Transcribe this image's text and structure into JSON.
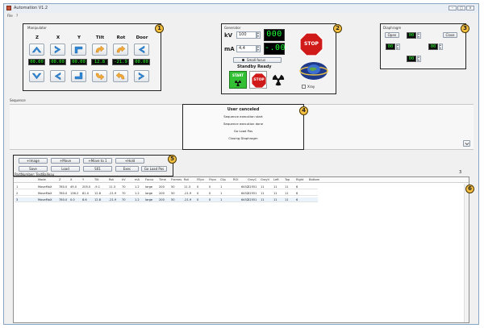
{
  "window": {
    "title": "Automation V1.2",
    "min_label": "–",
    "max_label": "□",
    "close_label": "×"
  },
  "menu": [
    "File",
    "?"
  ],
  "manipulator": {
    "label": "Manipulator",
    "columns": [
      "Z",
      "X",
      "Y",
      "Tilt",
      "Rot",
      "Door"
    ],
    "readouts": [
      "00.00",
      "00.00",
      "00.00",
      "12.8",
      "-21.9",
      "00.00"
    ]
  },
  "generator": {
    "label": "Generator",
    "kv_label": "kV",
    "kv_value": "100",
    "ma_label": "mA",
    "ma_value": "4,4",
    "kv_display": "000",
    "ma_display": "-.00",
    "small_focus_label": "Small focus",
    "standby_label": "Standby Ready",
    "start_label": "START",
    "stop_label": "STOP",
    "stop_sign_label": "STOP",
    "xray_label": "Xray"
  },
  "diaphragm": {
    "label": "Diaphragm",
    "open_label": "Open",
    "close_label": "Close",
    "displays": [
      "00",
      "00",
      "00",
      "00"
    ]
  },
  "sequence": {
    "label": "Sequence",
    "status_title": "User canceled",
    "status_lines": [
      "Sequence execution start",
      "Sequence execution done",
      "Go Load Pos",
      "Closing Diaphragm"
    ]
  },
  "toolbar": {
    "row1": [
      "+Image",
      "+Move",
      "+Move to 1",
      "+Hold"
    ],
    "row2": [
      "Save",
      "Load",
      "S01",
      "Exec",
      "Go Load Pos"
    ],
    "partnumber_label": "PartNumber: TestBalleau",
    "count": "3"
  },
  "callouts": [
    "1",
    "2",
    "3",
    "4",
    "5",
    "6"
  ],
  "table": {
    "headers": [
      "Mode",
      "Z",
      "X",
      "Y",
      "Tilt",
      "Rot",
      "kV",
      "mA",
      "Focus",
      "Time",
      "Frames",
      "Rot",
      "FEpn",
      "Fhpn",
      "Clip",
      "ROI",
      "GrayC",
      "GrayV",
      "Left",
      "Top",
      "Right",
      "Bottom"
    ],
    "rows": [
      [
        "1",
        "MoveMaX",
        "780.0",
        "49.0",
        "205.0",
        "-9.1",
        "11.3",
        "70",
        "1.2",
        "large",
        "200",
        "50",
        "11.3",
        "0",
        "0",
        "1",
        "",
        "6452",
        "22551",
        "11",
        "11",
        "11",
        "6"
      ],
      [
        "2",
        "MoveMaX",
        "780.0",
        "136.2",
        "81.0",
        "12.8",
        "-21.9",
        "70",
        "1.2",
        "large",
        "200",
        "50",
        "-21.9",
        "0",
        "0",
        "1",
        "",
        "6452",
        "22551",
        "11",
        "11",
        "11",
        "6"
      ],
      [
        "3",
        "MoveMaX",
        "780.0",
        "0.0",
        "8.6",
        "12.8",
        "-21.9",
        "70",
        "1.2",
        "large",
        "200",
        "50",
        "-21.9",
        "0",
        "0",
        "1",
        "",
        "6452",
        "22551",
        "11",
        "11",
        "11",
        "6"
      ]
    ]
  },
  "colors": {
    "callout": "#f6c043",
    "lcd_green": "#2cff2c",
    "stop_red": "#d01919",
    "start_green": "#34c034",
    "arrow_blue": "#2f86d4",
    "arrow_orange": "#f2a93b"
  }
}
